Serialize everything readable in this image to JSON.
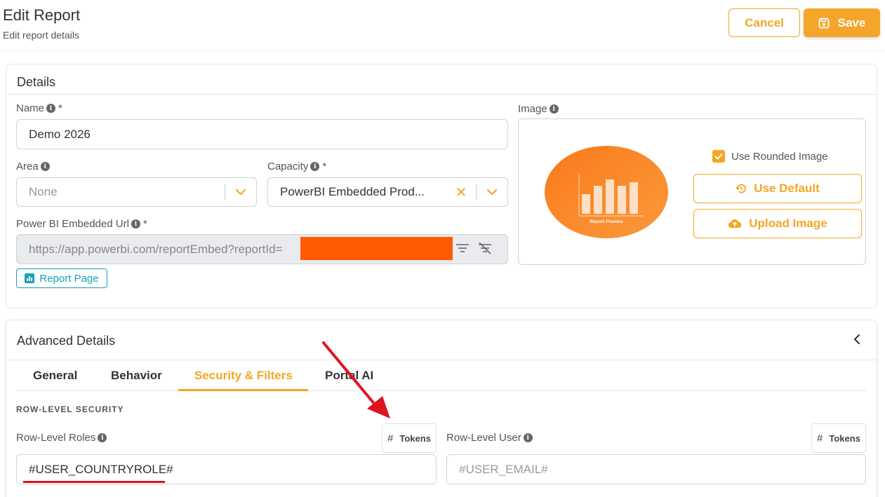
{
  "header": {
    "title": "Edit Report",
    "subtitle": "Edit report details",
    "cancel_label": "Cancel",
    "save_label": "Save"
  },
  "details": {
    "title": "Details",
    "name": {
      "label": "Name",
      "required": "*",
      "value": "Demo 2026"
    },
    "area": {
      "label": "Area",
      "placeholder": "None"
    },
    "capacity": {
      "label": "Capacity",
      "required": "*",
      "value": "PowerBI Embedded Prod..."
    },
    "url": {
      "label": "Power BI Embedded Url",
      "required": "*",
      "value": "https://app.powerbi.com/reportEmbed?reportId="
    },
    "report_page_label": "Report Page",
    "image": {
      "label": "Image",
      "preview_caption": "Report Preview",
      "use_rounded_label": "Use Rounded Image",
      "use_rounded_checked": true,
      "use_default_label": "Use Default",
      "upload_label": "Upload Image"
    }
  },
  "advanced": {
    "title": "Advanced Details",
    "tabs": [
      {
        "label": "General",
        "active": false
      },
      {
        "label": "Behavior",
        "active": false
      },
      {
        "label": "Security & Filters",
        "active": true
      },
      {
        "label": "Portal AI",
        "active": false
      }
    ],
    "section_title": "ROW-LEVEL SECURITY",
    "roles": {
      "label": "Row-Level Roles",
      "tokens_label": "Tokens",
      "value": "#USER_COUNTRYROLE#"
    },
    "user": {
      "label": "Row-Level User",
      "tokens_label": "Tokens",
      "placeholder": "#USER_EMAIL#"
    }
  },
  "colors": {
    "accent": "#f5a623",
    "teal": "#17a2b8",
    "annotation_red": "#e0141e",
    "redaction": "#ff5a00"
  }
}
